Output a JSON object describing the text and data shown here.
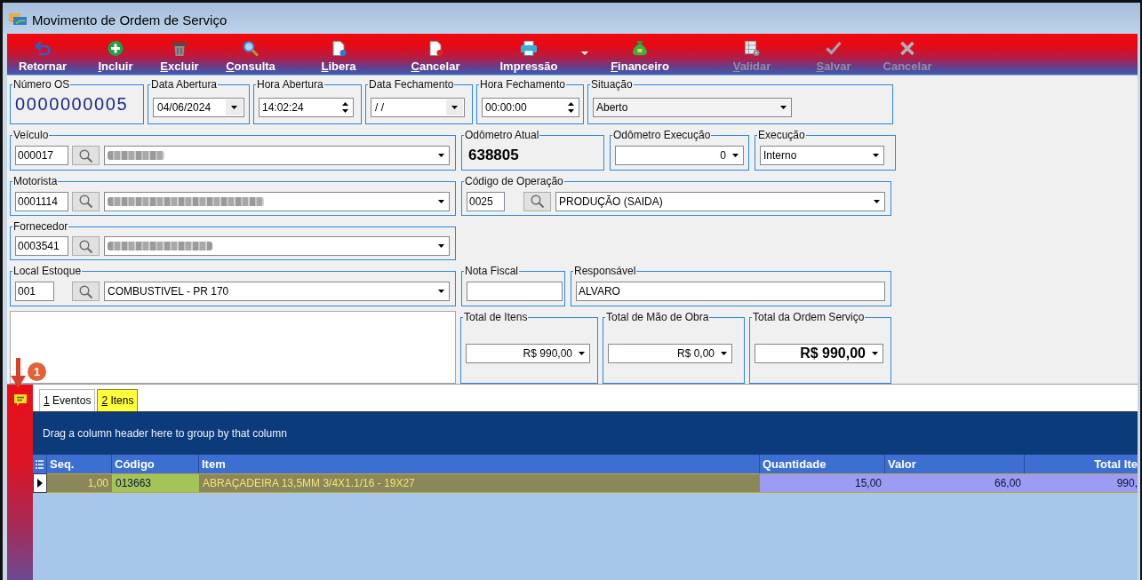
{
  "window": {
    "title": "Movimento de Ordem de Serviço"
  },
  "toolbar": [
    {
      "label": "Retornar",
      "accelerator": false,
      "disabled": false,
      "menu": false
    },
    {
      "label": "Incluir",
      "accelerator": true,
      "disabled": false,
      "menu": false
    },
    {
      "label": "Excluir",
      "accelerator": true,
      "disabled": false,
      "menu": false
    },
    {
      "label": "Consulta",
      "accelerator": true,
      "disabled": false,
      "menu": false
    },
    {
      "label": "Libera",
      "accelerator": true,
      "disabled": false,
      "menu": false
    },
    {
      "label": "Cancelar",
      "accelerator": true,
      "disabled": false,
      "menu": false
    },
    {
      "label": "Impressão",
      "accelerator": false,
      "disabled": false,
      "menu": true
    },
    {
      "label": "Financeiro",
      "accelerator": true,
      "disabled": false,
      "menu": false
    },
    {
      "label": "Validar",
      "accelerator": true,
      "disabled": true,
      "menu": false
    },
    {
      "label": "Salvar",
      "accelerator": true,
      "disabled": true,
      "menu": false
    },
    {
      "label": "Cancelar",
      "accelerator": false,
      "disabled": true,
      "menu": false
    }
  ],
  "form": {
    "numero_os": {
      "label": "Número OS",
      "value": "0000000005"
    },
    "data_abertura": {
      "label": "Data Abertura",
      "value": "04/06/2024"
    },
    "hora_abertura": {
      "label": "Hora Abertura",
      "value": "14:02:24"
    },
    "data_fechamento": {
      "label": "Data Fechamento",
      "value": "/ /"
    },
    "hora_fechamento": {
      "label": "Hora Fechamento",
      "value": "00:00:00"
    },
    "situacao": {
      "label": "Situação",
      "value": "Aberto"
    },
    "veiculo": {
      "label": "Veículo",
      "code": "000017",
      "redacted": true
    },
    "odometro_atual": {
      "label": "Odômetro Atual",
      "value": "638805"
    },
    "odometro_execucao": {
      "label": "Odômetro Execução",
      "value": "0"
    },
    "execucao": {
      "label": "Execução",
      "value": "Interno"
    },
    "motorista": {
      "label": "Motorista",
      "code": "0001114",
      "redacted": true
    },
    "codigo_operacao": {
      "label": "Código de Operação",
      "code": "0025",
      "value": "PRODUÇÃO (SAIDA)"
    },
    "fornecedor": {
      "label": "Fornecedor",
      "code": "0003541",
      "redacted": true
    },
    "local_estoque": {
      "label": "Local Estoque",
      "code": "001",
      "value": "COMBUSTIVEL - PR 170"
    },
    "nota_fiscal": {
      "label": "Nota Fiscal"
    },
    "responsavel": {
      "label": "Responsável",
      "value": "ALVARO"
    },
    "total_itens": {
      "label": "Total de Itens",
      "value": "R$ 990,00"
    },
    "total_mao_obra": {
      "label": "Total de Mão de Obra",
      "value": "R$ 0,00"
    },
    "total_ordem": {
      "label": "Total da Ordem Serviço",
      "value": "R$ 990,00"
    }
  },
  "annotation": {
    "badge": "1"
  },
  "tabs": [
    {
      "label": "1 Eventos",
      "selected": false,
      "accelerator": true
    },
    {
      "label": "2 Itens",
      "selected": true,
      "accelerator": true
    }
  ],
  "grid": {
    "group_hint": "Drag a column header here to group by that column",
    "columns": [
      {
        "label": "Seq.",
        "kind": "number",
        "color": "#8a8858"
      },
      {
        "label": "Código",
        "kind": "text",
        "color": "#a4c45a"
      },
      {
        "label": "Item",
        "kind": "text",
        "color": "#8a8858"
      },
      {
        "label": "Quantidade",
        "kind": "number",
        "color": "#9c9cf2"
      },
      {
        "label": "Valor",
        "kind": "number",
        "color": "#9c9cf2"
      },
      {
        "label": "Total Ite",
        "kind": "number",
        "color": "#9c9cf2"
      }
    ],
    "rows": [
      {
        "selected": true,
        "cells": [
          "1,00",
          "013663",
          "ABRAÇADEIRA 13,5MM 3/4X1.1/16 - 19X27",
          "15,00",
          "66,00",
          "990,"
        ]
      }
    ]
  }
}
